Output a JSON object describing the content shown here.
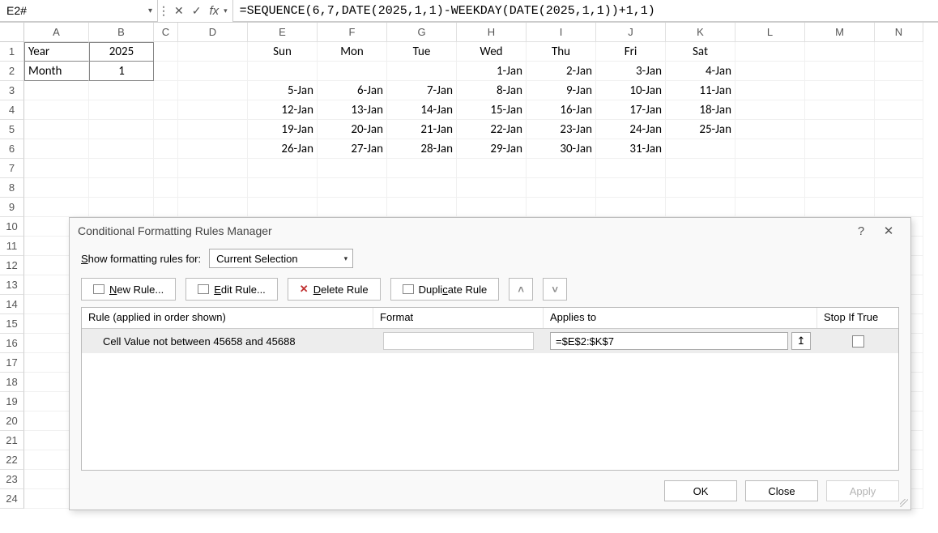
{
  "formula_bar": {
    "name_box": "E2#",
    "formula": "=SEQUENCE(6,7,DATE(2025,1,1)-WEEKDAY(DATE(2025,1,1))+1,1)"
  },
  "columns": [
    "A",
    "B",
    "C",
    "D",
    "E",
    "F",
    "G",
    "H",
    "I",
    "J",
    "K",
    "L",
    "M",
    "N"
  ],
  "rows": [
    "1",
    "2",
    "3",
    "4",
    "5",
    "6",
    "7",
    "8",
    "9",
    "10",
    "11",
    "12",
    "13",
    "14",
    "15",
    "16",
    "17",
    "18",
    "19",
    "20",
    "21",
    "22",
    "23",
    "24"
  ],
  "sheet": {
    "A1": "Year",
    "B1": "2025",
    "A2": "Month",
    "B2": "1",
    "header_days": [
      "Sun",
      "Mon",
      "Tue",
      "Wed",
      "Thu",
      "Fri",
      "Sat"
    ],
    "calendar": [
      [
        "",
        "",
        "",
        "1-Jan",
        "2-Jan",
        "3-Jan",
        "4-Jan"
      ],
      [
        "5-Jan",
        "6-Jan",
        "7-Jan",
        "8-Jan",
        "9-Jan",
        "10-Jan",
        "11-Jan"
      ],
      [
        "12-Jan",
        "13-Jan",
        "14-Jan",
        "15-Jan",
        "16-Jan",
        "17-Jan",
        "18-Jan"
      ],
      [
        "19-Jan",
        "20-Jan",
        "21-Jan",
        "22-Jan",
        "23-Jan",
        "24-Jan",
        "25-Jan"
      ],
      [
        "26-Jan",
        "27-Jan",
        "28-Jan",
        "29-Jan",
        "30-Jan",
        "31-Jan",
        ""
      ]
    ]
  },
  "dialog": {
    "title": "Conditional Formatting Rules Manager",
    "rules_for_label_pre": "S",
    "rules_for_label_post": "how formatting rules for:",
    "rules_for_value": "Current Selection",
    "buttons": {
      "new": "New Rule...",
      "edit": "Edit Rule...",
      "delete": "Delete Rule",
      "duplicate": "Duplicate Rule"
    },
    "headers": {
      "rule": "Rule (applied in order shown)",
      "format": "Format",
      "applies": "Applies to",
      "stop": "Stop If True"
    },
    "rule_row": {
      "description": "Cell Value not between 45658 and 45688",
      "applies_to": "=$E$2:$K$7"
    },
    "footer": {
      "ok": "OK",
      "close": "Close",
      "apply": "Apply"
    }
  }
}
